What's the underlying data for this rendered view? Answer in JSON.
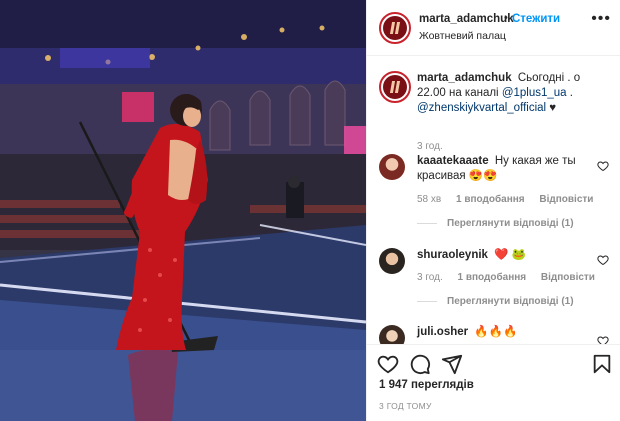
{
  "post": {
    "username": "marta_adamchuk",
    "separator": "•",
    "follow_label": "Стежити",
    "location": "Жовтневий палац",
    "more_icon": "more-dots-icon",
    "caption": {
      "username": "marta_adamchuk",
      "text_1": "Сьогодні . о 22.00 на каналі",
      "mention_1": "@1plus1_ua",
      "text_2": ".",
      "mention_2": "@zhenskiykvartal_official",
      "heart": "♥",
      "time": "3 год."
    },
    "comments": [
      {
        "username": "kaaatekaaate",
        "text": "Ну какая же ты красивая 😍😍",
        "time": "58 хв",
        "likes": "1 вподобання",
        "reply": "Відповісти",
        "view_replies": "Переглянути відповіді (1)"
      },
      {
        "username": "shuraoleynik",
        "text": "❤️ 🐸",
        "time": "3 год.",
        "likes": "1 вподобання",
        "reply": "Відповісти",
        "view_replies": "Переглянути відповіді (1)"
      },
      {
        "username": "juli.osher",
        "text": "🔥🔥🔥"
      }
    ],
    "views": "1 947 переглядів",
    "posted_ago": "3 ГОД ТОМУ",
    "colors": {
      "accent": "#0095f6",
      "text": "#262626",
      "muted": "#8e8e8e",
      "dress": "#c4141c"
    }
  }
}
